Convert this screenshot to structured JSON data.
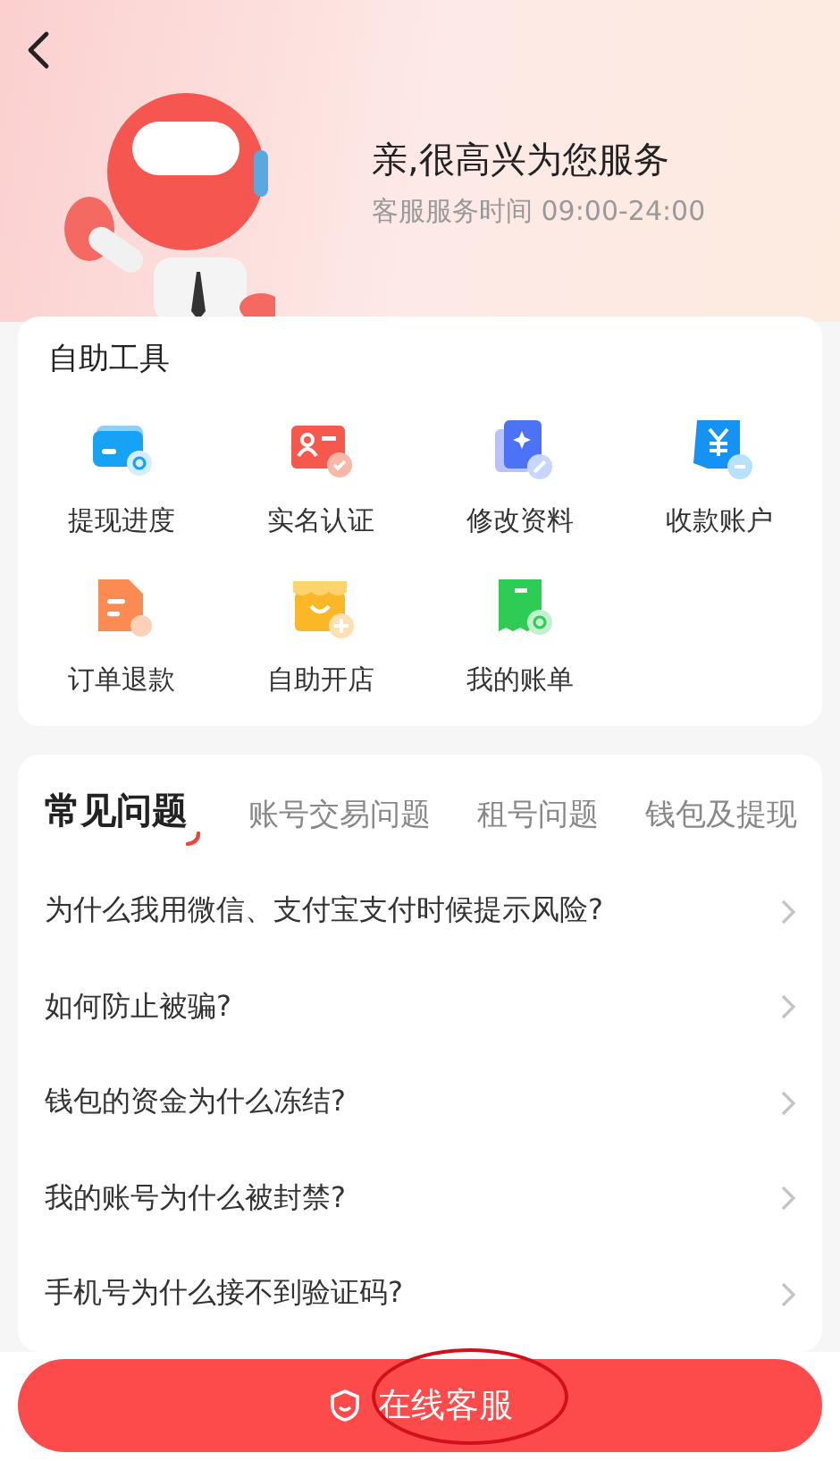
{
  "header": {
    "greeting": "亲,很高兴为您服务",
    "hours": "客服服务时间 09:00-24:00"
  },
  "tools": {
    "title": "自助工具",
    "items": [
      {
        "label": "提现进度"
      },
      {
        "label": "实名认证"
      },
      {
        "label": "修改资料"
      },
      {
        "label": "收款账户"
      },
      {
        "label": "订单退款"
      },
      {
        "label": "自助开店"
      },
      {
        "label": "我的账单"
      }
    ]
  },
  "faq": {
    "tabs": [
      {
        "label": "常见问题",
        "selected": true
      },
      {
        "label": "账号交易问题",
        "selected": false
      },
      {
        "label": "租号问题",
        "selected": false
      },
      {
        "label": "钱包及提现",
        "selected": false
      }
    ],
    "questions": [
      "为什么我用微信、支付宝支付时候提示风险?",
      "如何防止被骗?",
      "钱包的资金为什么冻结?",
      "我的账号为什么被封禁?",
      "手机号为什么接不到验证码?"
    ]
  },
  "service_button": {
    "label": "在线客服",
    "circled": true
  }
}
